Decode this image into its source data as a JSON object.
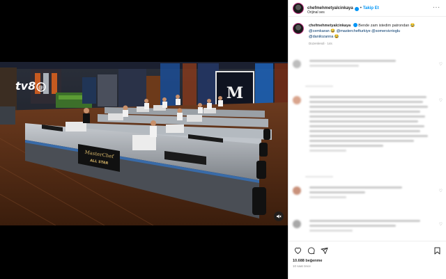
{
  "post": {
    "username": "chefmehmetyalcinkaya",
    "follow_label": "Takip Et",
    "audio": "Orijinal ses",
    "more_icon": "more-options-icon"
  },
  "caption": {
    "username": "chefmehmetyalcinkaya",
    "text": "Bende zam istedim patrondan 😂",
    "mentions_line1": "@cemkaran 😂 @masterchefturkiye @somersivrioglu",
    "mentions_line2": "@danilozanna 😂",
    "meta": "Düzenlendi · 14s"
  },
  "actions": {
    "likes": "10.688 beğenme",
    "time": "10 saat önce"
  },
  "colors": {
    "verified": "#0095f6",
    "link": "#00376b",
    "secondary_text": "#8e8e8e"
  }
}
